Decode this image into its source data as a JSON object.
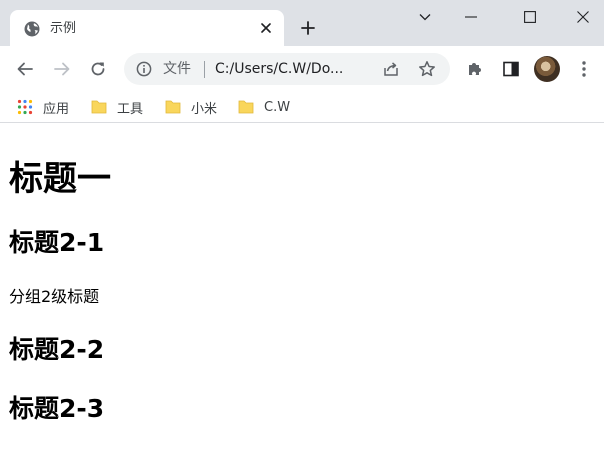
{
  "tab": {
    "title": "示例"
  },
  "toolbar": {
    "address": {
      "scheme_label": "文件",
      "url": "C:/Users/C.W/Do..."
    }
  },
  "bookmarks": [
    {
      "label": "应用",
      "icon": "apps-grid-icon"
    },
    {
      "label": "工具",
      "icon": "folder-icon"
    },
    {
      "label": "小米",
      "icon": "folder-icon"
    },
    {
      "label": "C.W",
      "icon": "folder-icon"
    }
  ],
  "content": {
    "heading1": "标题一",
    "heading2_1": "标题2-1",
    "paragraph": "分组2级标题",
    "heading2_2": "标题2-2",
    "heading2_3": "标题2-3"
  },
  "colors": {
    "tab_strip": "#dee1e6",
    "omnibox": "#f1f3f4",
    "folder": "#f9d65c"
  }
}
